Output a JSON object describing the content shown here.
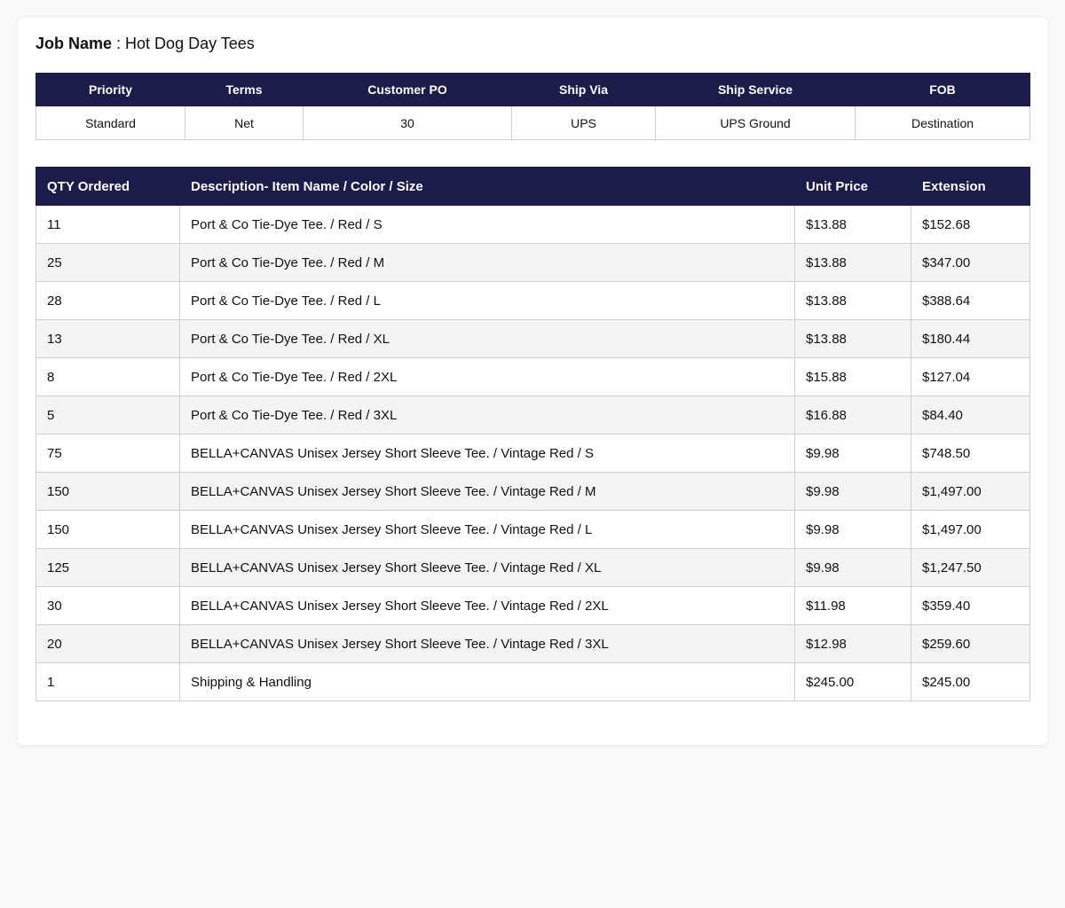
{
  "job": {
    "label": "Job Name",
    "separator": " : ",
    "value": "Hot Dog Day Tees"
  },
  "info": {
    "headers": [
      "Priority",
      "Terms",
      "Customer PO",
      "Ship Via",
      "Ship Service",
      "FOB"
    ],
    "values": [
      "Standard",
      "Net",
      "30",
      "UPS",
      "UPS Ground",
      "Destination"
    ]
  },
  "items": {
    "headers": [
      "QTY Ordered",
      "Description- Item Name / Color / Size",
      "Unit Price",
      "Extension"
    ],
    "rows": [
      {
        "qty": "11",
        "desc": "Port & Co Tie-Dye Tee. / Red / S",
        "price": "$13.88",
        "ext": "$152.68"
      },
      {
        "qty": "25",
        "desc": "Port & Co Tie-Dye Tee. / Red / M",
        "price": "$13.88",
        "ext": "$347.00"
      },
      {
        "qty": "28",
        "desc": "Port & Co Tie-Dye Tee. / Red / L",
        "price": "$13.88",
        "ext": "$388.64"
      },
      {
        "qty": "13",
        "desc": "Port & Co Tie-Dye Tee. / Red / XL",
        "price": "$13.88",
        "ext": "$180.44"
      },
      {
        "qty": "8",
        "desc": "Port & Co Tie-Dye Tee. / Red / 2XL",
        "price": "$15.88",
        "ext": "$127.04"
      },
      {
        "qty": "5",
        "desc": "Port & Co Tie-Dye Tee. / Red / 3XL",
        "price": "$16.88",
        "ext": "$84.40"
      },
      {
        "qty": "75",
        "desc": "BELLA+CANVAS Unisex Jersey Short Sleeve Tee. / Vintage Red / S",
        "price": "$9.98",
        "ext": "$748.50"
      },
      {
        "qty": "150",
        "desc": "BELLA+CANVAS Unisex Jersey Short Sleeve Tee. / Vintage Red / M",
        "price": "$9.98",
        "ext": "$1,497.00"
      },
      {
        "qty": "150",
        "desc": "BELLA+CANVAS Unisex Jersey Short Sleeve Tee. / Vintage Red / L",
        "price": "$9.98",
        "ext": "$1,497.00"
      },
      {
        "qty": "125",
        "desc": "BELLA+CANVAS Unisex Jersey Short Sleeve Tee. / Vintage Red / XL",
        "price": "$9.98",
        "ext": "$1,247.50"
      },
      {
        "qty": "30",
        "desc": "BELLA+CANVAS Unisex Jersey Short Sleeve Tee. / Vintage Red / 2XL",
        "price": "$11.98",
        "ext": "$359.40"
      },
      {
        "qty": "20",
        "desc": "BELLA+CANVAS Unisex Jersey Short Sleeve Tee. / Vintage Red / 3XL",
        "price": "$12.98",
        "ext": "$259.60"
      },
      {
        "qty": "1",
        "desc": "Shipping & Handling",
        "price": "$245.00",
        "ext": "$245.00"
      }
    ]
  },
  "colors": {
    "header_bg": "#1c1c4a",
    "header_text": "#ffffff",
    "stripe": "#f4f4f4",
    "border": "#cfcfcf"
  }
}
